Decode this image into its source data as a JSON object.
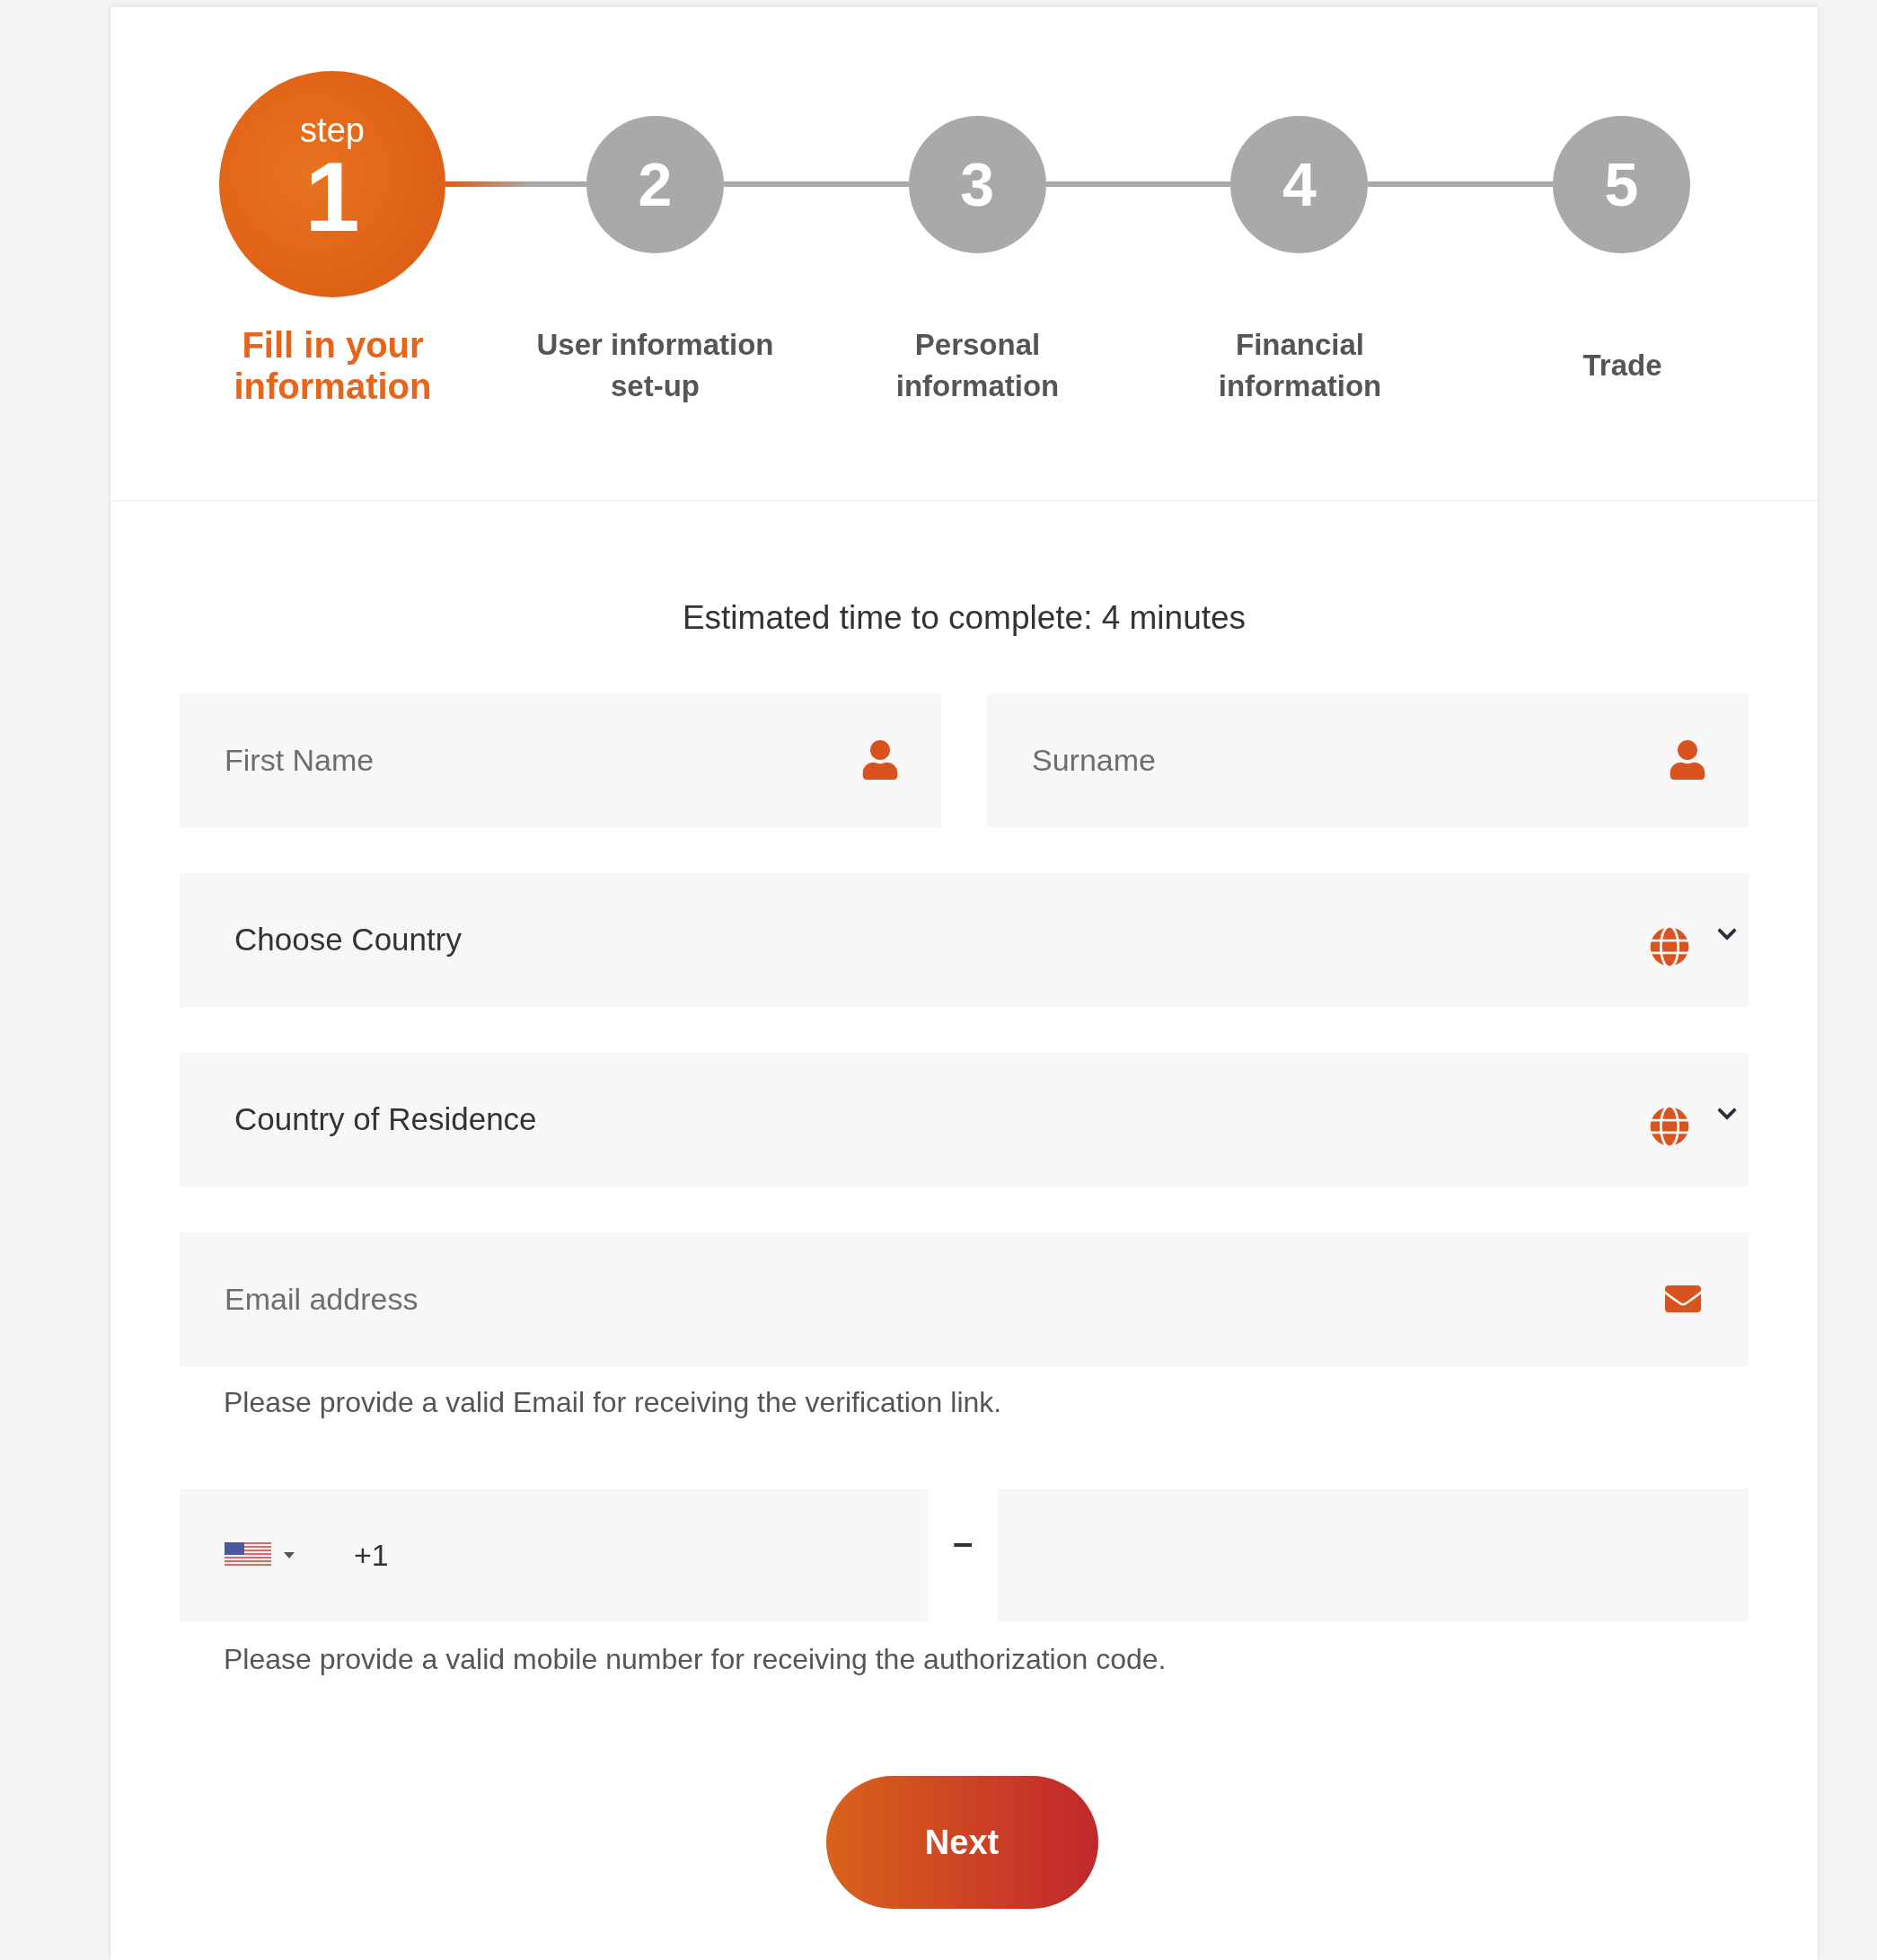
{
  "steps": [
    {
      "prefix": "step",
      "number": "1",
      "label": "Fill in your information",
      "selected": true
    },
    {
      "number": "2",
      "label": "User information set-up",
      "selected": false
    },
    {
      "number": "3",
      "label": "Personal information",
      "selected": false
    },
    {
      "number": "4",
      "label": "Financial information",
      "selected": false
    },
    {
      "number": "5",
      "label": "Trade",
      "selected": false
    }
  ],
  "estimate": "Estimated time to complete: 4 minutes",
  "name_fields": [
    {
      "placeholder": "First Name"
    },
    {
      "placeholder": "Surname"
    }
  ],
  "country_selects": [
    {
      "value": "Choose Country"
    },
    {
      "value": "Country of Residence"
    }
  ],
  "email": {
    "placeholder": "Email address",
    "hint": "Please provide a valid Email for receiving the verification link."
  },
  "phone": {
    "dial_code": "+1",
    "separator": "–",
    "hint": "Please provide a valid mobile number for receiving the authorization code."
  },
  "next_button": "Next"
}
